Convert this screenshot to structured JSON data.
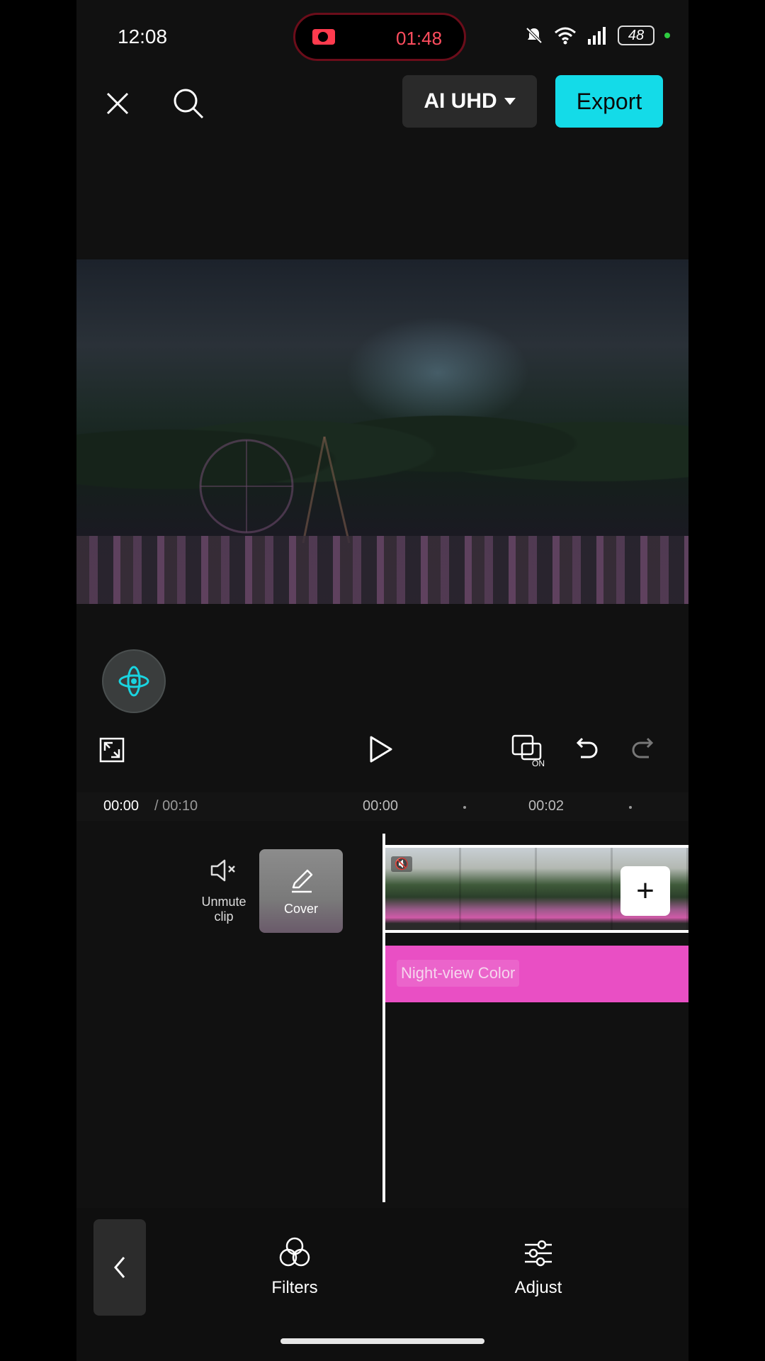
{
  "status_bar": {
    "time": "12:08",
    "recording_time": "01:48",
    "battery": "48",
    "icons": [
      "bell-mute-icon",
      "wifi-icon",
      "signal-icon",
      "battery-icon"
    ]
  },
  "top_bar": {
    "close_icon": "close-icon",
    "search_icon": "search-icon",
    "quality_label": "AI UHD",
    "export_label": "Export"
  },
  "playback": {
    "current_time": "00:00",
    "total_time": "/ 00:10",
    "ruler_labels": [
      "00:00",
      "00:02"
    ]
  },
  "timeline": {
    "unmute_label": "Unmute clip",
    "cover_label": "Cover",
    "filter_clip_label": "Night-view Color"
  },
  "bottom_toolbar": {
    "tools": [
      {
        "label": "Filters",
        "icon": "filters-icon"
      },
      {
        "label": "Adjust",
        "icon": "adjust-icon"
      }
    ]
  },
  "colors": {
    "accent": "#14dbe8",
    "filter_strip": "#e94fc4",
    "recording": "#ff4d5e"
  }
}
